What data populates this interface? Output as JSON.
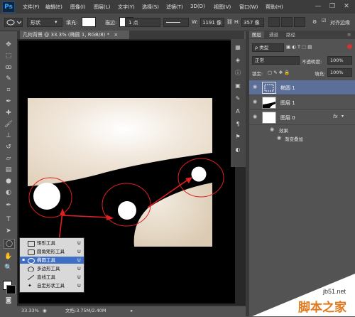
{
  "app": {
    "logo": "Ps"
  },
  "menu": [
    "文件(F)",
    "编辑(E)",
    "图像(I)",
    "图层(L)",
    "文字(Y)",
    "选择(S)",
    "滤镜(T)",
    "3D(D)",
    "视图(V)",
    "窗口(W)",
    "帮助(H)"
  ],
  "window_controls": {
    "minimize": "—",
    "restore": "❐",
    "close": "✕"
  },
  "options_bar": {
    "tool_icon": "ellipse-icon",
    "mode": "形状",
    "fill_label": "填充:",
    "stroke_label": "描边:",
    "stroke_width": "1 点",
    "w_label": "W:",
    "w_value": "1191 像",
    "h_label": "H:",
    "h_value": "357 像",
    "align_edges": "对齐边缘"
  },
  "document": {
    "tab_title": "几何背景 @ 33.3% (椭圆 1, RGB/8) *",
    "tab_close": "×"
  },
  "tool_popup": {
    "items": [
      {
        "label": "矩形工具",
        "shortcut": "U",
        "selected": false
      },
      {
        "label": "圆角矩形工具",
        "shortcut": "U",
        "selected": false
      },
      {
        "label": "椭圆工具",
        "shortcut": "U",
        "selected": true
      },
      {
        "label": "多边形工具",
        "shortcut": "U",
        "selected": false
      },
      {
        "label": "直线工具",
        "shortcut": "U",
        "selected": false
      },
      {
        "label": "自定形状工具",
        "shortcut": "U",
        "selected": false
      }
    ]
  },
  "status_bar": {
    "zoom": "33.33%",
    "doc_info": "文档:3.75M/2.40M"
  },
  "layers_panel": {
    "tabs": [
      "图层",
      "通道",
      "路径"
    ],
    "filter_label": "类型",
    "blend_mode": "正常",
    "opacity_label": "不透明度:",
    "opacity_value": "100%",
    "lock_label": "锁定:",
    "fill_label": "填充:",
    "fill_value": "100%",
    "layers": [
      {
        "name": "椭圆 1",
        "selected": true
      },
      {
        "name": "图层 1",
        "selected": false
      },
      {
        "name": "图层 0",
        "selected": false,
        "fx": "fx"
      }
    ],
    "effects_label": "效果",
    "gradient_overlay": "渐变叠加"
  },
  "watermark": {
    "url": "jb51.net",
    "name": "脚本之家"
  },
  "colors": {
    "selection_blue": "#3f6fc4",
    "annotation_red": "#e02020",
    "canvas_bg": "#000000",
    "beige": "#e8dccc"
  }
}
